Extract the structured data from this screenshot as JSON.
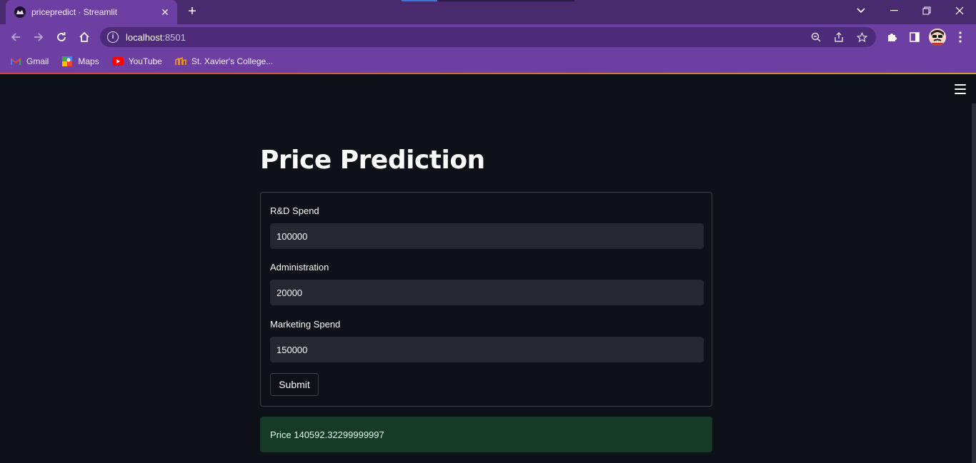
{
  "browser": {
    "tab_title": "pricepredict · Streamlit",
    "url_host": "localhost",
    "url_port": ":8501",
    "bookmarks": [
      {
        "label": "Gmail",
        "icon": "gmail-icon"
      },
      {
        "label": "Maps",
        "icon": "maps-icon"
      },
      {
        "label": "YouTube",
        "icon": "youtube-icon"
      },
      {
        "label": "St. Xavier's College...",
        "icon": "college-icon"
      }
    ],
    "accent": "#6d3fa3"
  },
  "app": {
    "title": "Price Prediction",
    "form": {
      "fields": [
        {
          "label": "R&D Spend",
          "value": "100000"
        },
        {
          "label": "Administration",
          "value": "20000"
        },
        {
          "label": "Marketing Spend",
          "value": "150000"
        }
      ],
      "submit_label": "Submit"
    },
    "result": "Price 140592.32299999997",
    "colors": {
      "background": "#0e1117",
      "input": "#262730",
      "success": "#173928"
    }
  }
}
